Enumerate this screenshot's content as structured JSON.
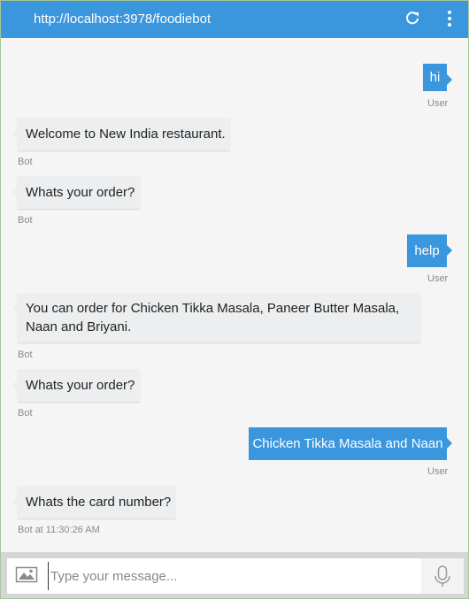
{
  "header": {
    "url": "http://localhost:3978/foodiebot",
    "refresh_icon": "refresh-icon",
    "menu_icon": "more-vertical-icon",
    "background_color": "#3a96dd"
  },
  "messages": [
    {
      "from": "user",
      "text": "hi",
      "meta": "User"
    },
    {
      "from": "bot",
      "text": "Welcome to New India restaurant.",
      "meta": "Bot"
    },
    {
      "from": "bot",
      "text": "Whats your order?",
      "meta": "Bot"
    },
    {
      "from": "user",
      "text": "help",
      "meta": "User"
    },
    {
      "from": "bot",
      "text": "You can order for Chicken Tikka Masala, Paneer Butter Masala, Naan and Briyani.",
      "meta": "Bot"
    },
    {
      "from": "bot",
      "text": "Whats your order?",
      "meta": "Bot"
    },
    {
      "from": "user",
      "text": "Chicken Tikka Masala and Naan",
      "meta": "User"
    },
    {
      "from": "bot",
      "text": "Whats the card number?",
      "meta": "Bot at 11:30:26 AM"
    }
  ],
  "input": {
    "placeholder": "Type your message...",
    "value": "",
    "image_icon": "image-upload-icon",
    "mic_icon": "microphone-icon"
  }
}
